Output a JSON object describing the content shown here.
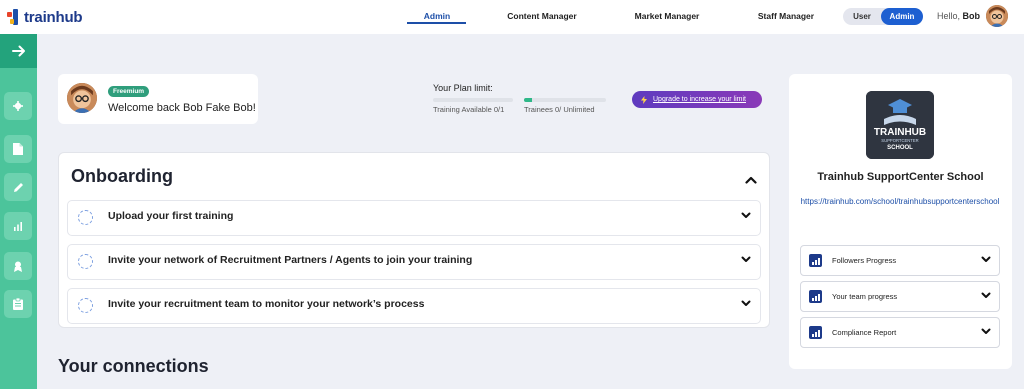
{
  "app": {
    "logo_text": "trainhub"
  },
  "nav": {
    "admin": "Admin",
    "content": "Content Manager",
    "market": "Market Manager",
    "staff": "Staff Manager"
  },
  "toggle": {
    "user": "User",
    "admin": "Admin",
    "selected": "Admin"
  },
  "header": {
    "hello": "Hello,",
    "user_name": "Bob"
  },
  "sidebar": {
    "top_icon": "arrow-right-icon",
    "items": [
      {
        "icon": "gear-icon"
      },
      {
        "icon": "document-icon"
      },
      {
        "icon": "pencil-icon"
      },
      {
        "icon": "bar-chart-icon"
      },
      {
        "icon": "user-badge-icon"
      },
      {
        "icon": "clipboard-icon"
      }
    ]
  },
  "welcome": {
    "badge": "Freemium",
    "text": "Welcome back Bob Fake Bob!"
  },
  "plan": {
    "title": "Your Plan limit:",
    "training_label": "Training Available 0/1",
    "training_fill": 0,
    "trainees_label": "Trainees 0/ Unlimited",
    "trainees_fill": 0.1,
    "upgrade_label": "Upgrade to increase your limit"
  },
  "onboarding": {
    "title": "Onboarding",
    "items": [
      {
        "label": "Upload your first training"
      },
      {
        "label": "Invite your network of Recruitment Partners / Agents to join your training"
      },
      {
        "label": "Invite your recruitment team to monitor your network’s process"
      }
    ]
  },
  "connections": {
    "title": "Your connections"
  },
  "school": {
    "name": "Trainhub SupportCenter School",
    "url": "https://trainhub.com/school/trainhubsupportcenterschool",
    "logo_lines": [
      "TRAINHUB",
      "SUPPORTCENTER",
      "SCHOOL"
    ],
    "reports": [
      {
        "label": "Followers Progress"
      },
      {
        "label": "Your team progress"
      },
      {
        "label": "Compliance Report"
      }
    ]
  },
  "colors": {
    "accent": "#1d5fd1",
    "sidebar": "#4cc49b",
    "sidebar_dark": "#23a37c",
    "badge": "#2f9e7c",
    "upgrade_start": "#5e3bbf",
    "upgrade_end": "#8a3ab8"
  }
}
